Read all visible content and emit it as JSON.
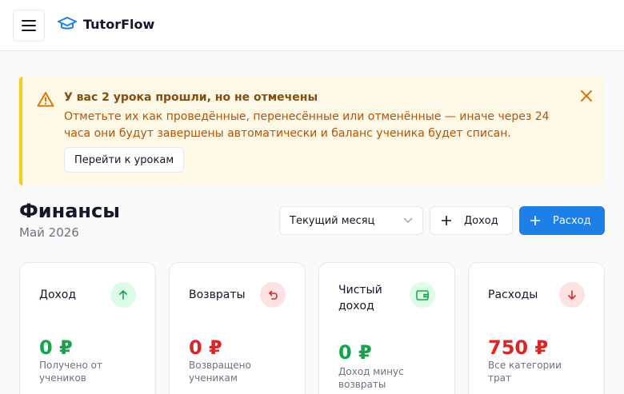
{
  "app": {
    "name": "TutorFlow"
  },
  "alert": {
    "title": "У вас 2 урока прошли, но не отмечены",
    "text": "Отметьте их как проведённые, перенесённые или отменённые — иначе через 24 часа они будут завершены автоматически и баланс ученика будет списан.",
    "action_label": "Перейти к урокам"
  },
  "page": {
    "title": "Финансы",
    "subtitle": "Май 2026"
  },
  "toolbar": {
    "period_value": "Текущий месяц",
    "income_label": "Доход",
    "expense_label": "Расход"
  },
  "cards": [
    {
      "label": "Доход",
      "value": "0 ₽",
      "desc": "Получено от учеников",
      "icon": "arrow-up-icon",
      "accent": "#16a34a"
    },
    {
      "label": "Возвраты",
      "value": "0 ₽",
      "desc": "Возвращено ученикам",
      "icon": "undo-icon",
      "accent": "#dc2626"
    },
    {
      "label": "Чистый доход",
      "value": "0 ₽",
      "desc": "Доход минус возвраты",
      "icon": "wallet-icon",
      "accent": "#16a34a"
    },
    {
      "label": "Расходы",
      "value": "750 ₽",
      "desc": "Все категории трат",
      "icon": "arrow-down-icon",
      "accent": "#dc2626"
    }
  ],
  "colors": {
    "primary": "#1d7fe8",
    "warning_bg": "#fef9e7",
    "warning_border": "#facc15",
    "positive": "#16a34a",
    "negative": "#dc2626"
  }
}
